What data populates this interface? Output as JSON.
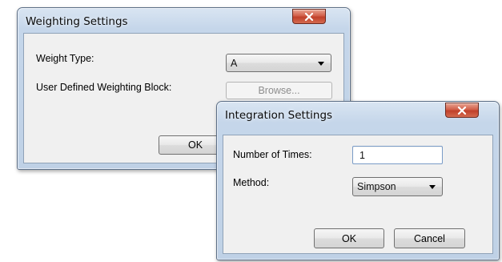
{
  "weighting_dialog": {
    "title": "Weighting Settings",
    "close_glyph": "x",
    "weight_type_label": "Weight Type:",
    "weight_type_value": "A",
    "user_block_label": "User Defined Weighting Block:",
    "browse_label": "Browse...",
    "ok_label": "OK"
  },
  "integration_dialog": {
    "title": "Integration Settings",
    "close_glyph": "x",
    "times_label": "Number of Times:",
    "times_value": "1",
    "method_label": "Method:",
    "method_value": "Simpson",
    "ok_label": "OK",
    "cancel_label": "Cancel"
  },
  "colors": {
    "title_bar": "#c5d6ea",
    "close_button": "#c0402a",
    "client_area": "#f0f0f0"
  },
  "icons": {
    "close": "close-icon",
    "dropdown": "chevron-down-icon"
  }
}
